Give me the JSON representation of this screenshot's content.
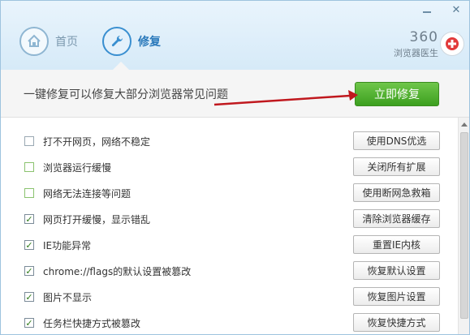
{
  "header": {
    "tabs": [
      {
        "label": "首页",
        "icon": "home-icon",
        "active": false
      },
      {
        "label": "修复",
        "icon": "wrench-icon",
        "active": true
      }
    ],
    "brand_number": "360",
    "brand_subtitle": "浏览器医生",
    "window_controls": [
      "minimize",
      "close"
    ]
  },
  "action_bar": {
    "text": "一键修复可以修复大部分浏览器常见问题",
    "button": "立即修复"
  },
  "items": [
    {
      "label": "打不开网页，网络不稳定",
      "button": "使用DNS优选",
      "checked": false
    },
    {
      "label": "浏览器运行缓慢",
      "button": "关闭所有扩展",
      "checked": false
    },
    {
      "label": "网络无法连接等问题",
      "button": "使用断网急救箱",
      "checked": false
    },
    {
      "label": "网页打开缓慢，显示错乱",
      "button": "清除浏览器缓存",
      "checked": true
    },
    {
      "label": "IE功能异常",
      "button": "重置IE内核",
      "checked": true
    },
    {
      "label": "chrome://flags的默认设置被篡改",
      "button": "恢复默认设置",
      "checked": true
    },
    {
      "label": "图片不显示",
      "button": "恢复图片设置",
      "checked": true
    },
    {
      "label": "任务栏快捷方式被篡改",
      "button": "恢复快捷方式",
      "checked": true
    }
  ],
  "colors": {
    "accent": "#2a79bb",
    "repair_button": "#4aaf2a",
    "arrow": "#c0181e"
  }
}
